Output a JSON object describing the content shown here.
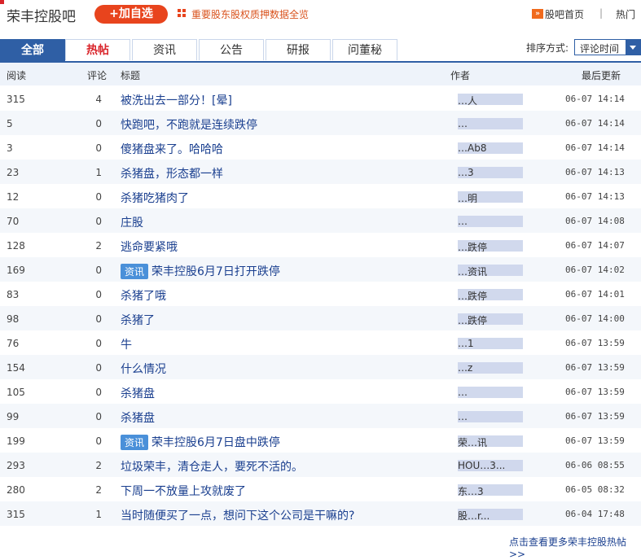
{
  "header": {
    "bar_title": "荣丰控股吧",
    "add_button": "+加自选",
    "notice": "重要股东股权质押数据全览",
    "home_link": "股吧首页",
    "separator": "|",
    "hot_link": "热门"
  },
  "tabs": [
    "全部",
    "热帖",
    "资讯",
    "公告",
    "研报",
    "问董秘"
  ],
  "sort": {
    "label": "排序方式:",
    "value": "评论时间"
  },
  "columns": {
    "read": "阅读",
    "comments": "评论",
    "title": "标题",
    "author": "作者",
    "updated": "最后更新"
  },
  "rows": [
    {
      "read": "315",
      "comments": "4",
      "title": "被洗出去一部分！[晕]",
      "badge": "",
      "author": "…人",
      "date": "06-07 14:14"
    },
    {
      "read": "5",
      "comments": "0",
      "title": "快跑吧，不跑就是连续跌停",
      "badge": "",
      "author": "…",
      "date": "06-07 14:14"
    },
    {
      "read": "3",
      "comments": "0",
      "title": "傻猪盘来了。哈哈哈",
      "badge": "",
      "author": "…Ab8",
      "date": "06-07 14:14"
    },
    {
      "read": "23",
      "comments": "1",
      "title": "杀猪盘，形态都一样",
      "badge": "",
      "author": "…3",
      "date": "06-07 14:13"
    },
    {
      "read": "12",
      "comments": "0",
      "title": "杀猪吃猪肉了",
      "badge": "",
      "author": "…明",
      "date": "06-07 14:13"
    },
    {
      "read": "70",
      "comments": "0",
      "title": "庄股",
      "badge": "",
      "author": "…",
      "date": "06-07 14:08"
    },
    {
      "read": "128",
      "comments": "2",
      "title": "逃命要紧哦",
      "badge": "",
      "author": "…跌停",
      "date": "06-07 14:07"
    },
    {
      "read": "169",
      "comments": "0",
      "title": "荣丰控股6月7日打开跌停",
      "badge": "资讯",
      "author": "…资讯",
      "date": "06-07 14:02"
    },
    {
      "read": "83",
      "comments": "0",
      "title": "杀猪了哦",
      "badge": "",
      "author": "…跌停",
      "date": "06-07 14:01"
    },
    {
      "read": "98",
      "comments": "0",
      "title": "杀猪了",
      "badge": "",
      "author": "…跌停",
      "date": "06-07 14:00"
    },
    {
      "read": "76",
      "comments": "0",
      "title": "牛",
      "badge": "",
      "author": "…1",
      "date": "06-07 13:59"
    },
    {
      "read": "154",
      "comments": "0",
      "title": "什么情况",
      "badge": "",
      "author": "…z",
      "date": "06-07 13:59"
    },
    {
      "read": "105",
      "comments": "0",
      "title": "杀猪盘",
      "badge": "",
      "author": "…",
      "date": "06-07 13:59"
    },
    {
      "read": "99",
      "comments": "0",
      "title": "杀猪盘",
      "badge": "",
      "author": "…",
      "date": "06-07 13:59"
    },
    {
      "read": "199",
      "comments": "0",
      "title": "荣丰控股6月7日盘中跌停",
      "badge": "资讯",
      "author": "荣…讯",
      "date": "06-07 13:59"
    },
    {
      "read": "293",
      "comments": "2",
      "title": "垃圾荣丰，清仓走人，要死不活的。",
      "badge": "",
      "author": "HOU…3...",
      "date": "06-06 08:55"
    },
    {
      "read": "280",
      "comments": "2",
      "title": "下周一不放量上攻就废了",
      "badge": "",
      "author": "东…3",
      "date": "06-05 08:32"
    },
    {
      "read": "315",
      "comments": "1",
      "title": "当时随便买了一点，想问下这个公司是干嘛的?",
      "badge": "",
      "author": "股…r...",
      "date": "06-04 17:48"
    }
  ],
  "more_link": "点击查看更多荣丰控股热帖>>"
}
